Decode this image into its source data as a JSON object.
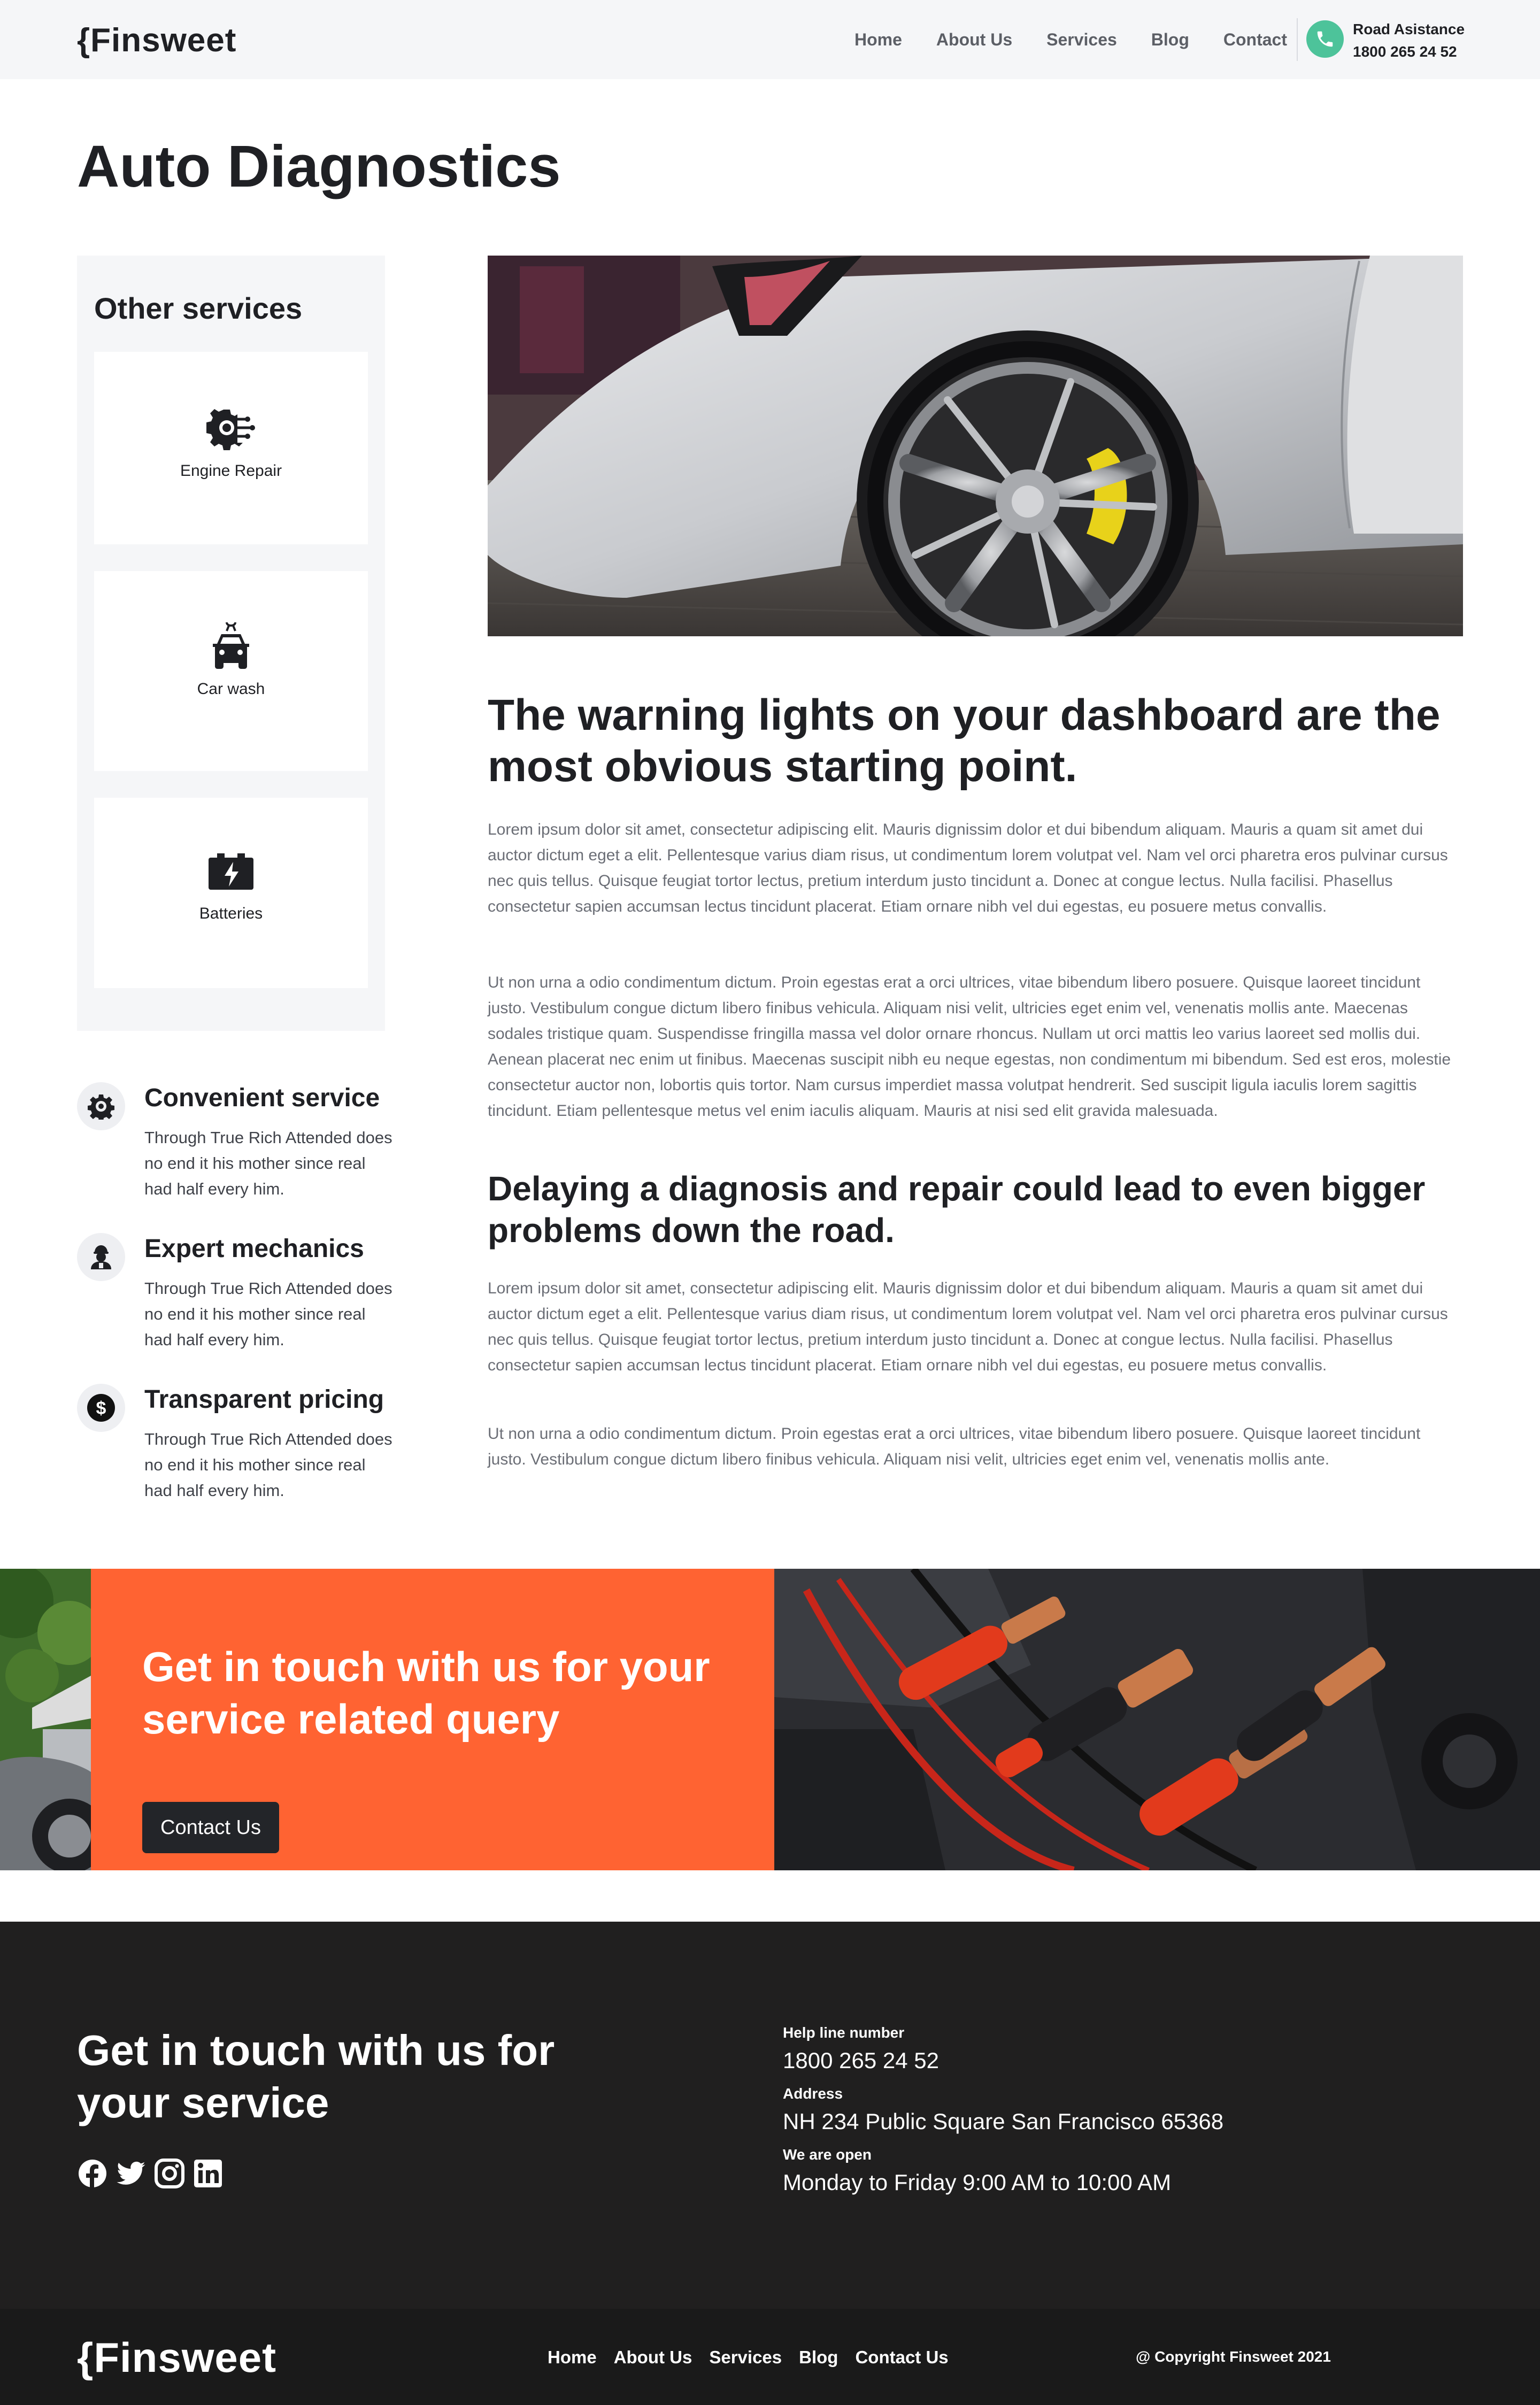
{
  "brand": {
    "logo": "{Finsweet"
  },
  "nav": {
    "items": [
      "Home",
      "About Us",
      "Services",
      "Blog",
      "Contact"
    ],
    "road_label": "Road Asistance",
    "road_phone": "1800 265 24 52",
    "phone_icon": "phone-icon"
  },
  "page": {
    "title": "Auto Diagnostics"
  },
  "sidebar": {
    "title": "Other services",
    "services": [
      {
        "label": "Engine Repair",
        "icon": "engine-gear-icon"
      },
      {
        "label": "Car wash",
        "icon": "car-wash-icon"
      },
      {
        "label": "Batteries",
        "icon": "battery-icon"
      }
    ]
  },
  "features": [
    {
      "title": "Convenient service",
      "text": "Through True Rich Attended does no end it his mother since real had half every him.",
      "icon": "gear-icon"
    },
    {
      "title": "Expert mechanics",
      "text": "Through True Rich Attended does no end it his mother since real had half every him.",
      "icon": "mechanic-icon"
    },
    {
      "title": "Transparent pricing",
      "text": "Through True Rich Attended does no end it his mother since real had half every him.",
      "icon": "dollar-icon"
    }
  ],
  "article": {
    "heading1": "The warning lights on your dashboard are the most obvious starting point.",
    "p1": "Lorem ipsum dolor sit amet, consectetur adipiscing elit. Mauris dignissim dolor et dui bibendum aliquam. Mauris a quam sit amet dui auctor dictum eget a elit. Pellentesque varius diam risus, ut condimentum lorem volutpat vel. Nam vel orci pharetra eros pulvinar cursus nec quis tellus. Quisque feugiat tortor lectus, pretium interdum justo tincidunt a. Donec at congue lectus. Nulla facilisi. Phasellus consectetur sapien accumsan lectus tincidunt placerat. Etiam ornare nibh vel dui egestas, eu posuere metus convallis.",
    "p2": "Ut non urna a odio condimentum dictum. Proin egestas erat a orci ultrices, vitae bibendum libero posuere. Quisque laoreet tincidunt justo. Vestibulum congue dictum libero finibus vehicula. Aliquam nisi velit, ultricies eget enim vel, venenatis mollis ante. Maecenas sodales tristique quam. Suspendisse fringilla massa vel dolor ornare rhoncus. Nullam ut orci mattis leo varius laoreet sed mollis dui. Aenean placerat nec enim ut finibus. Maecenas suscipit nibh eu neque egestas, non condimentum mi bibendum. Sed est eros, molestie consectetur auctor non, lobortis quis tortor. Nam cursus imperdiet massa volutpat hendrerit. Sed suscipit ligula iaculis lorem sagittis tincidunt. Etiam pellentesque metus vel enim iaculis aliquam. Mauris at nisi sed elit gravida malesuada.",
    "heading2": "Delaying a diagnosis and repair could lead to even bigger problems down the road.",
    "p3": "Lorem ipsum dolor sit amet, consectetur adipiscing elit. Mauris dignissim dolor et dui bibendum aliquam. Mauris a quam sit amet dui auctor dictum eget a elit. Pellentesque varius diam risus, ut condimentum lorem volutpat vel. Nam vel orci pharetra eros pulvinar cursus nec quis tellus. Quisque feugiat tortor lectus, pretium interdum justo tincidunt a. Donec at congue lectus. Nulla facilisi. Phasellus consectetur sapien accumsan lectus tincidunt placerat. Etiam ornare nibh vel dui egestas, eu posuere metus convallis.",
    "p4": "Ut non urna a odio condimentum dictum. Proin egestas erat a orci ultrices, vitae bibendum libero posuere. Quisque laoreet tincidunt justo. Vestibulum congue dictum libero finibus vehicula. Aliquam nisi velit, ultricies eget enim vel, venenatis mollis ante."
  },
  "cta": {
    "title": "Get in touch with us for your service related query",
    "button": "Contact Us"
  },
  "footer": {
    "heading": "Get in touch with us for your service",
    "socials": [
      "facebook-icon",
      "twitter-icon",
      "instagram-icon",
      "linkedin-icon"
    ],
    "help_label": "Help line number",
    "help_value": "1800 265 24 52",
    "address_label": "Address",
    "address_value": "NH 234 Public Square San Francisco 65368",
    "open_label": "We are open",
    "open_value": "Monday to Friday 9:00 AM to  10:00  AM"
  },
  "bottom": {
    "logo": "{Finsweet",
    "items": [
      "Home",
      "About Us",
      "Services",
      "Blog",
      "Contact Us"
    ],
    "copyright": "@ Copyright Finsweet 2021"
  },
  "colors": {
    "accent": "#ff6332",
    "phone": "#4dc39a",
    "dark": "#201f1f"
  }
}
